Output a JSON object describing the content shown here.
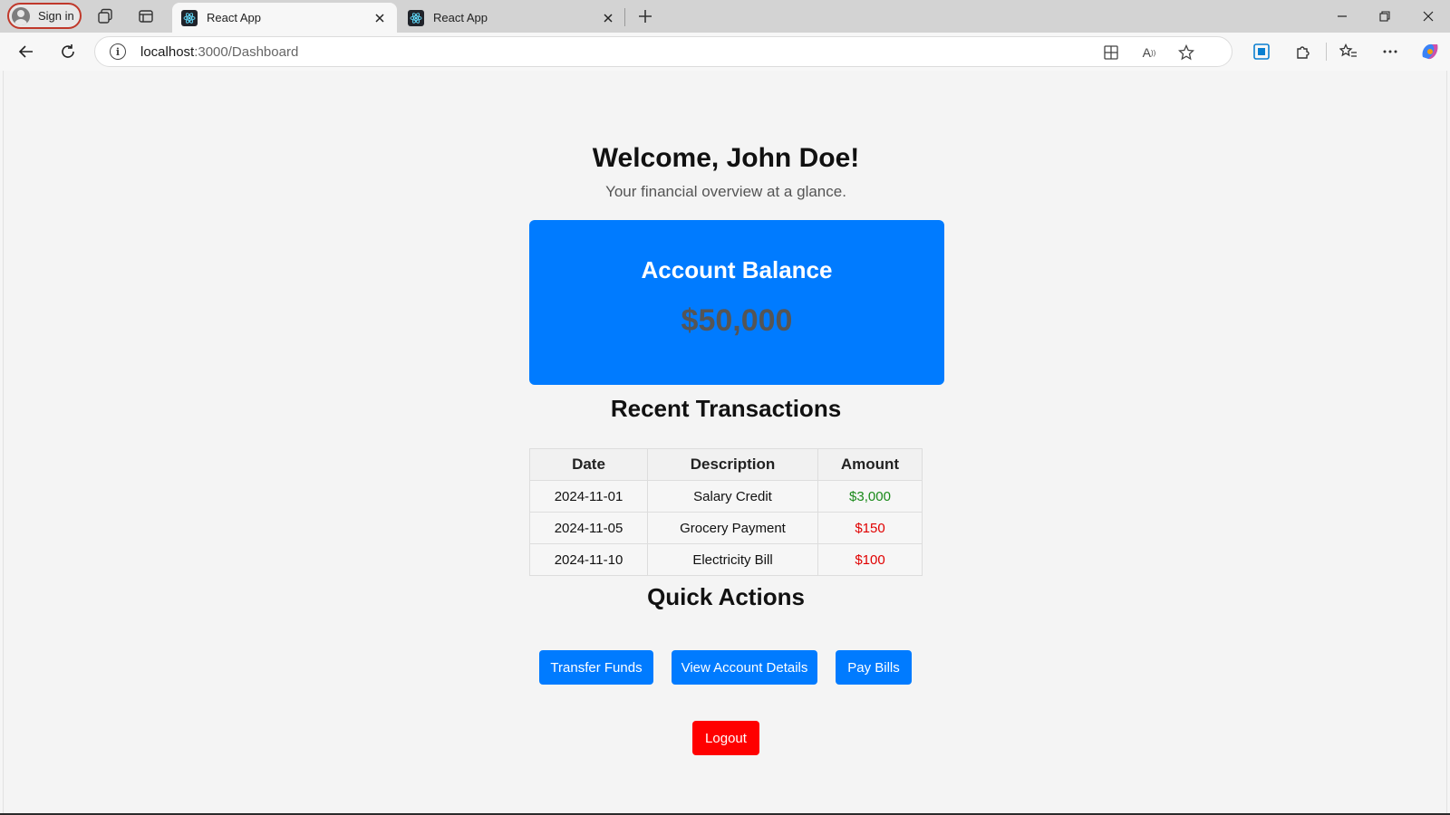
{
  "browser": {
    "signin_label": "Sign in",
    "tabs": [
      {
        "title": "React App",
        "active": true,
        "icon": "react-icon"
      },
      {
        "title": "React App",
        "active": false,
        "icon": "react-icon"
      }
    ],
    "url_host": "localhost",
    "url_path": ":3000/Dashboard"
  },
  "dashboard": {
    "welcome": "Welcome, John Doe!",
    "subtitle": "Your financial overview at a glance.",
    "balance": {
      "title": "Account Balance",
      "amount": "$50,000"
    },
    "transactions": {
      "heading": "Recent Transactions",
      "columns": [
        "Date",
        "Description",
        "Amount"
      ],
      "rows": [
        {
          "date": "2024-11-01",
          "description": "Salary Credit",
          "amount": "$3,000",
          "type": "credit"
        },
        {
          "date": "2024-11-05",
          "description": "Grocery Payment",
          "amount": "$150",
          "type": "debit"
        },
        {
          "date": "2024-11-10",
          "description": "Electricity Bill",
          "amount": "$100",
          "type": "debit"
        }
      ]
    },
    "quick_actions": {
      "heading": "Quick Actions",
      "buttons": [
        "Transfer Funds",
        "View Account Details",
        "Pay Bills"
      ]
    },
    "logout_label": "Logout"
  },
  "colors": {
    "primary": "#007bff",
    "danger": "#ff0000",
    "credit": "#1a8a1a",
    "debit": "#e00000"
  }
}
